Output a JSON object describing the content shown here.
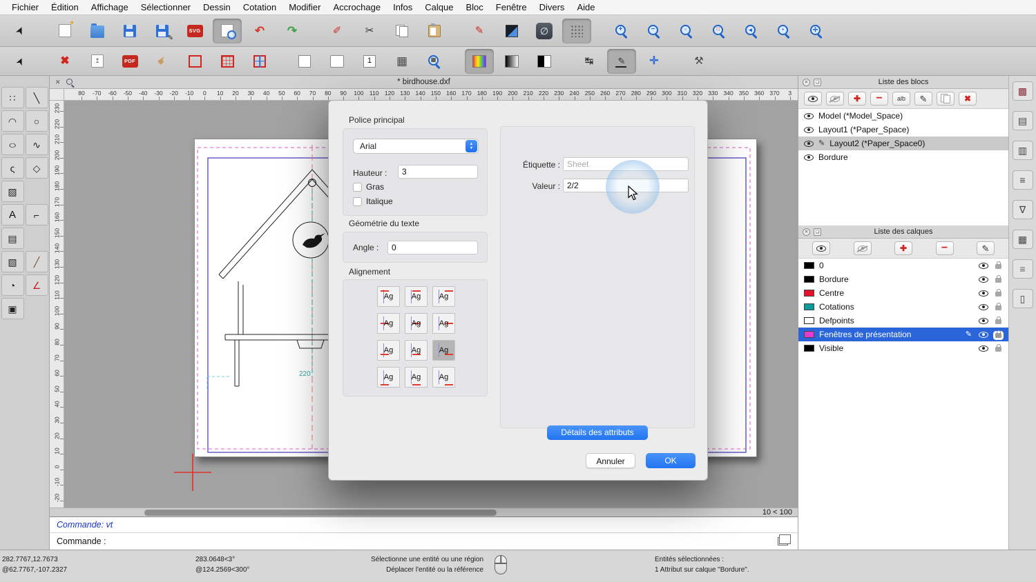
{
  "app": {
    "accent_blue": "#2f7cf6",
    "selection_blue": "#2a65d9",
    "highlight_gray": "#c9c9c9"
  },
  "menu": {
    "items": [
      "Fichier",
      "Édition",
      "Affichage",
      "Sélectionner",
      "Dessin",
      "Cotation",
      "Modifier",
      "Accrochage",
      "Infos",
      "Calque",
      "Bloc",
      "Fenêtre",
      "Divers",
      "Aide"
    ]
  },
  "toolbar_row1": [
    {
      "n": "pointer-tool",
      "g": "➤",
      "c": "#1a1a1a",
      "rot": -65,
      "fs": 15
    },
    {
      "sep": true
    },
    {
      "n": "new-file",
      "base": "page",
      "g": "✦",
      "c": "#e3a300",
      "fs": 9,
      "cls": "tr"
    },
    {
      "n": "open-file",
      "base": "folder"
    },
    {
      "n": "save-file",
      "base": "floppy"
    },
    {
      "n": "save-as-file",
      "base": "floppy",
      "g": "✎",
      "c": "#222",
      "fs": 10,
      "cls": "br"
    },
    {
      "n": "svg-export",
      "chip": "SVG",
      "bg": "#c4281e"
    },
    {
      "n": "print-preview",
      "base": "pagemag",
      "active": true
    },
    {
      "n": "undo",
      "g": "↶",
      "c": "#d43a2e",
      "fs": 17,
      "bold": true
    },
    {
      "n": "redo",
      "g": "↷",
      "c": "#3fa14b",
      "fs": 17,
      "bold": true
    },
    {
      "sep": true
    },
    {
      "n": "erase-tool",
      "g": "✐",
      "c": "#cf2b20",
      "fs": 15
    },
    {
      "n": "cut",
      "g": "✂",
      "c": "#333",
      "fs": 15
    },
    {
      "n": "copy",
      "base": "pages"
    },
    {
      "n": "paste",
      "base": "clip"
    },
    {
      "sep": true
    },
    {
      "n": "pen-tool",
      "g": "✎",
      "c": "#cf2b20",
      "fs": 15
    },
    {
      "n": "selection-tool",
      "base": "sel"
    },
    {
      "n": "null-layer-toggle",
      "base": "darkchip",
      "g": "∅",
      "c": "#e8edf4",
      "fs": 14
    },
    {
      "n": "grid-toggle",
      "base": "dots",
      "active": true
    },
    {
      "sep": true
    },
    {
      "n": "zoom-in",
      "base": "mag",
      "g": "+",
      "c": "#1f63c8",
      "fs": 10
    },
    {
      "n": "zoom-out",
      "base": "mag",
      "g": "−",
      "c": "#1f63c8",
      "fs": 10
    },
    {
      "n": "zoom-auto",
      "base": "mag",
      "g": "▫",
      "c": "#1f63c8",
      "fs": 8
    },
    {
      "n": "zoom-reference",
      "base": "mag",
      "g": "∷",
      "c": "#d43a2e",
      "fs": 8
    },
    {
      "n": "zoom-previous",
      "base": "mag",
      "g": "◂",
      "c": "#1f63c8",
      "fs": 9
    },
    {
      "n": "zoom-window",
      "base": "mag",
      "g": "▪",
      "c": "#1f63c8",
      "fs": 8
    },
    {
      "n": "zoom-pan",
      "base": "mag",
      "g": "✛",
      "c": "#1f63c8",
      "fs": 9
    }
  ],
  "toolbar_row2": [
    {
      "n": "pointer-select",
      "g": "➤",
      "c": "#1a1a1a",
      "rot": -65,
      "fs": 14
    },
    {
      "sep": true
    },
    {
      "n": "delete-entities",
      "g": "✖",
      "c": "#d1261f",
      "fs": 16,
      "bold": true
    },
    {
      "n": "export-print",
      "base": "page",
      "g": "↥",
      "c": "#555",
      "fs": 9
    },
    {
      "n": "pdf-export",
      "chip": "PDF",
      "bg": "#c4281e"
    },
    {
      "n": "pan-hand",
      "g": "☛",
      "c": "#c99a62",
      "fs": 15,
      "rot": -40
    },
    {
      "n": "viewport-border",
      "base": "redrect"
    },
    {
      "n": "viewport-grid",
      "base": "redgrid"
    },
    {
      "n": "viewport-crosshair",
      "base": "redcross"
    },
    {
      "sep": true
    },
    {
      "n": "paper-portrait",
      "base": "paperp"
    },
    {
      "n": "paper-landscape",
      "base": "paperl"
    },
    {
      "n": "single-viewport",
      "base": "chipwhite",
      "g": "1",
      "c": "#111",
      "fs": 11
    },
    {
      "n": "grid-table",
      "g": "▦",
      "c": "#4a4a4a",
      "fs": 17
    },
    {
      "n": "zoom-grid",
      "base": "mag",
      "g": "▦",
      "c": "#555",
      "fs": 8
    },
    {
      "sep": true
    },
    {
      "n": "color-picker",
      "base": "rainbow",
      "active": true
    },
    {
      "n": "gradient-bar",
      "base": "grad"
    },
    {
      "n": "bw-bar",
      "base": "bw"
    },
    {
      "sep": true
    },
    {
      "n": "auto-dimension",
      "g": "↹",
      "c": "#222",
      "fs": 15
    },
    {
      "n": "polyline-mode",
      "base": "penline",
      "g": "✎",
      "c": "#333",
      "fs": 13,
      "active": true
    },
    {
      "n": "add-node",
      "g": "✛",
      "c": "#2f6fd6",
      "fs": 16,
      "bold": true
    },
    {
      "sep": true
    },
    {
      "n": "dev-tools",
      "g": "⚒",
      "c": "#4a4a4a",
      "fs": 15
    }
  ],
  "palette": [
    {
      "n": "points-tool",
      "g": "∷",
      "c": "#222"
    },
    {
      "n": "line-tool",
      "g": "╲",
      "c": "#222"
    },
    {
      "n": "arc-tool",
      "g": "◠",
      "c": "#222"
    },
    {
      "n": "circle-tool",
      "g": "○",
      "c": "#222"
    },
    {
      "n": "ellipse-tool",
      "g": "○",
      "c": "#222",
      "cls": "stretch"
    },
    {
      "n": "spline-tool",
      "g": "∿",
      "c": "#222"
    },
    {
      "n": "freehand-tool",
      "g": "ς",
      "c": "#222"
    },
    {
      "n": "polygon-tool",
      "g": "◇",
      "c": "#222"
    },
    {
      "n": "hatch-tool",
      "g": "▨",
      "c": "#222"
    },
    {
      "n": "spacer",
      "g": ""
    },
    {
      "n": "text-tool",
      "g": "A",
      "c": "#111",
      "fs": 15
    },
    {
      "n": "dimension-tool",
      "g": "⌐",
      "c": "#222"
    },
    {
      "n": "image-tool",
      "g": "▤",
      "c": "#222"
    },
    {
      "n": "spacer2",
      "g": ""
    },
    {
      "n": "pattern-tool",
      "g": "▧",
      "c": "#222"
    },
    {
      "n": "measure-tool",
      "g": "╱",
      "c": "#7a5230"
    },
    {
      "n": "divide-tool",
      "g": "◔",
      "c": "#222"
    },
    {
      "n": "angle-tool",
      "g": "∠",
      "c": "#c22222"
    },
    {
      "n": "block-tool",
      "g": "▣",
      "c": "#222"
    }
  ],
  "document": {
    "title": "* birdhouse.dxf"
  },
  "rulers": {
    "horizontal": [
      "80",
      "-70",
      "-60",
      "-50",
      "-40",
      "-30",
      "-20",
      "-10",
      "0",
      "10",
      "20",
      "30",
      "40",
      "50",
      "60",
      "70",
      "80",
      "90",
      "100",
      "110",
      "120",
      "130",
      "140",
      "150",
      "160",
      "170",
      "180",
      "190",
      "200",
      "210",
      "220",
      "230",
      "240",
      "250",
      "260",
      "270",
      "280",
      "290",
      "300",
      "310",
      "320",
      "330",
      "340",
      "350",
      "360",
      "370",
      "3"
    ],
    "vertical": [
      "230",
      "220",
      "210",
      "200",
      "190",
      "180",
      "170",
      "160",
      "150",
      "140",
      "130",
      "120",
      "110",
      "100",
      "90",
      "80",
      "70",
      "60",
      "50",
      "40",
      "30",
      "20",
      "10",
      "0",
      "-10",
      "-20"
    ]
  },
  "canvas": {
    "dim_label": "220",
    "zoom_label": "10 < 100"
  },
  "dialog": {
    "font_section_label": "Police principal",
    "font_name": "Arial",
    "height_label": "Hauteur :",
    "height_value": "3",
    "bold_label": "Gras",
    "italic_label": "Italique",
    "geometry_section_label": "Géométrie du texte",
    "angle_label": "Angle :",
    "angle_value": "0",
    "alignment": {
      "section_label": "Alignement",
      "button_label": "Ag",
      "selected_index": 8
    },
    "tag_label": "Étiquette :",
    "tag_placeholder": "Sheet",
    "value_label": "Valeur :",
    "value_text": "2/2",
    "details_button": "Détails des attributs",
    "cancel_button": "Annuler",
    "ok_button": "OK"
  },
  "blocks_panel": {
    "title": "Liste des blocs",
    "tools": [
      {
        "n": "show-block",
        "kind": "eye"
      },
      {
        "n": "hide-all-blocks",
        "kind": "eyeoff"
      },
      {
        "n": "add-block",
        "g": "✚",
        "c": "#d1261f",
        "fs": 12,
        "bold": true
      },
      {
        "n": "remove-block",
        "g": "−",
        "c": "#d1261f",
        "fs": 16,
        "bold": true
      },
      {
        "n": "rename-block",
        "txt": "alb"
      },
      {
        "n": "edit-block",
        "g": "✎",
        "c": "#333",
        "fs": 13
      },
      {
        "n": "duplicate-block",
        "kind": "pages"
      },
      {
        "n": "delete-block",
        "g": "✖",
        "c": "#d1261f",
        "fs": 12,
        "bold": true
      }
    ],
    "items": [
      {
        "name": "Model (*Model_Space)"
      },
      {
        "name": "Layout1 (*Paper_Space)"
      },
      {
        "name": "Layout2 (*Paper_Space0)",
        "selected": true,
        "edit": true
      },
      {
        "name": "Bordure"
      }
    ]
  },
  "layers_panel": {
    "title": "Liste des calques",
    "tools": [
      {
        "n": "show-layer",
        "kind": "eye"
      },
      {
        "n": "hide-all-layers",
        "kind": "eyeoff"
      },
      {
        "n": "add-layer",
        "g": "✚",
        "c": "#d1261f",
        "fs": 12,
        "bold": true
      },
      {
        "n": "remove-layer",
        "g": "−",
        "c": "#d1261f",
        "fs": 16,
        "bold": true
      },
      {
        "n": "edit-layer",
        "g": "✎",
        "c": "#333",
        "fs": 13
      }
    ],
    "items": [
      {
        "name": "0",
        "color": "#000000"
      },
      {
        "name": "Bordure",
        "color": "#000000"
      },
      {
        "name": "Centre",
        "color": "#e8112d"
      },
      {
        "name": "Cotations",
        "color": "#0d9b9b"
      },
      {
        "name": "Defpoints",
        "color": "#ffffff"
      },
      {
        "name": "Fenêtres de présentation",
        "color": "#e23bd4",
        "selected": true
      },
      {
        "name": "Visible",
        "color": "#000000"
      }
    ]
  },
  "right_strip": [
    {
      "n": "panel-blocks",
      "g": "▩",
      "c": "#8a3038"
    },
    {
      "n": "panel-library",
      "g": "▤",
      "c": "#444"
    },
    {
      "n": "panel-properties",
      "g": "▥",
      "c": "#444"
    },
    {
      "n": "panel-command-history",
      "g": "≡",
      "c": "#444"
    },
    {
      "n": "panel-selection-filter",
      "g": "∇",
      "c": "#444"
    },
    {
      "n": "panel-layer-table",
      "g": "▦",
      "c": "#444"
    },
    {
      "n": "panel-scripts",
      "g": "≡",
      "c": "#666"
    },
    {
      "n": "panel-clipboard",
      "g": "▯",
      "c": "#444"
    }
  ],
  "command": {
    "history": "Commande: vt",
    "prompt": "Commande :"
  },
  "status": {
    "abs_coord": "282.7767,12.7673",
    "rel_coord": "@62.7767,-107.2327",
    "polar_abs": "283.0648<3°",
    "polar_rel": "@124.2569<300°",
    "hint1": "Sélectionne une entité ou une région",
    "hint2": "Déplacer l'entité ou la référence",
    "sel1": "Entités sélectionnées :",
    "sel2": "1 Attribut sur calque \"Bordure\"."
  }
}
